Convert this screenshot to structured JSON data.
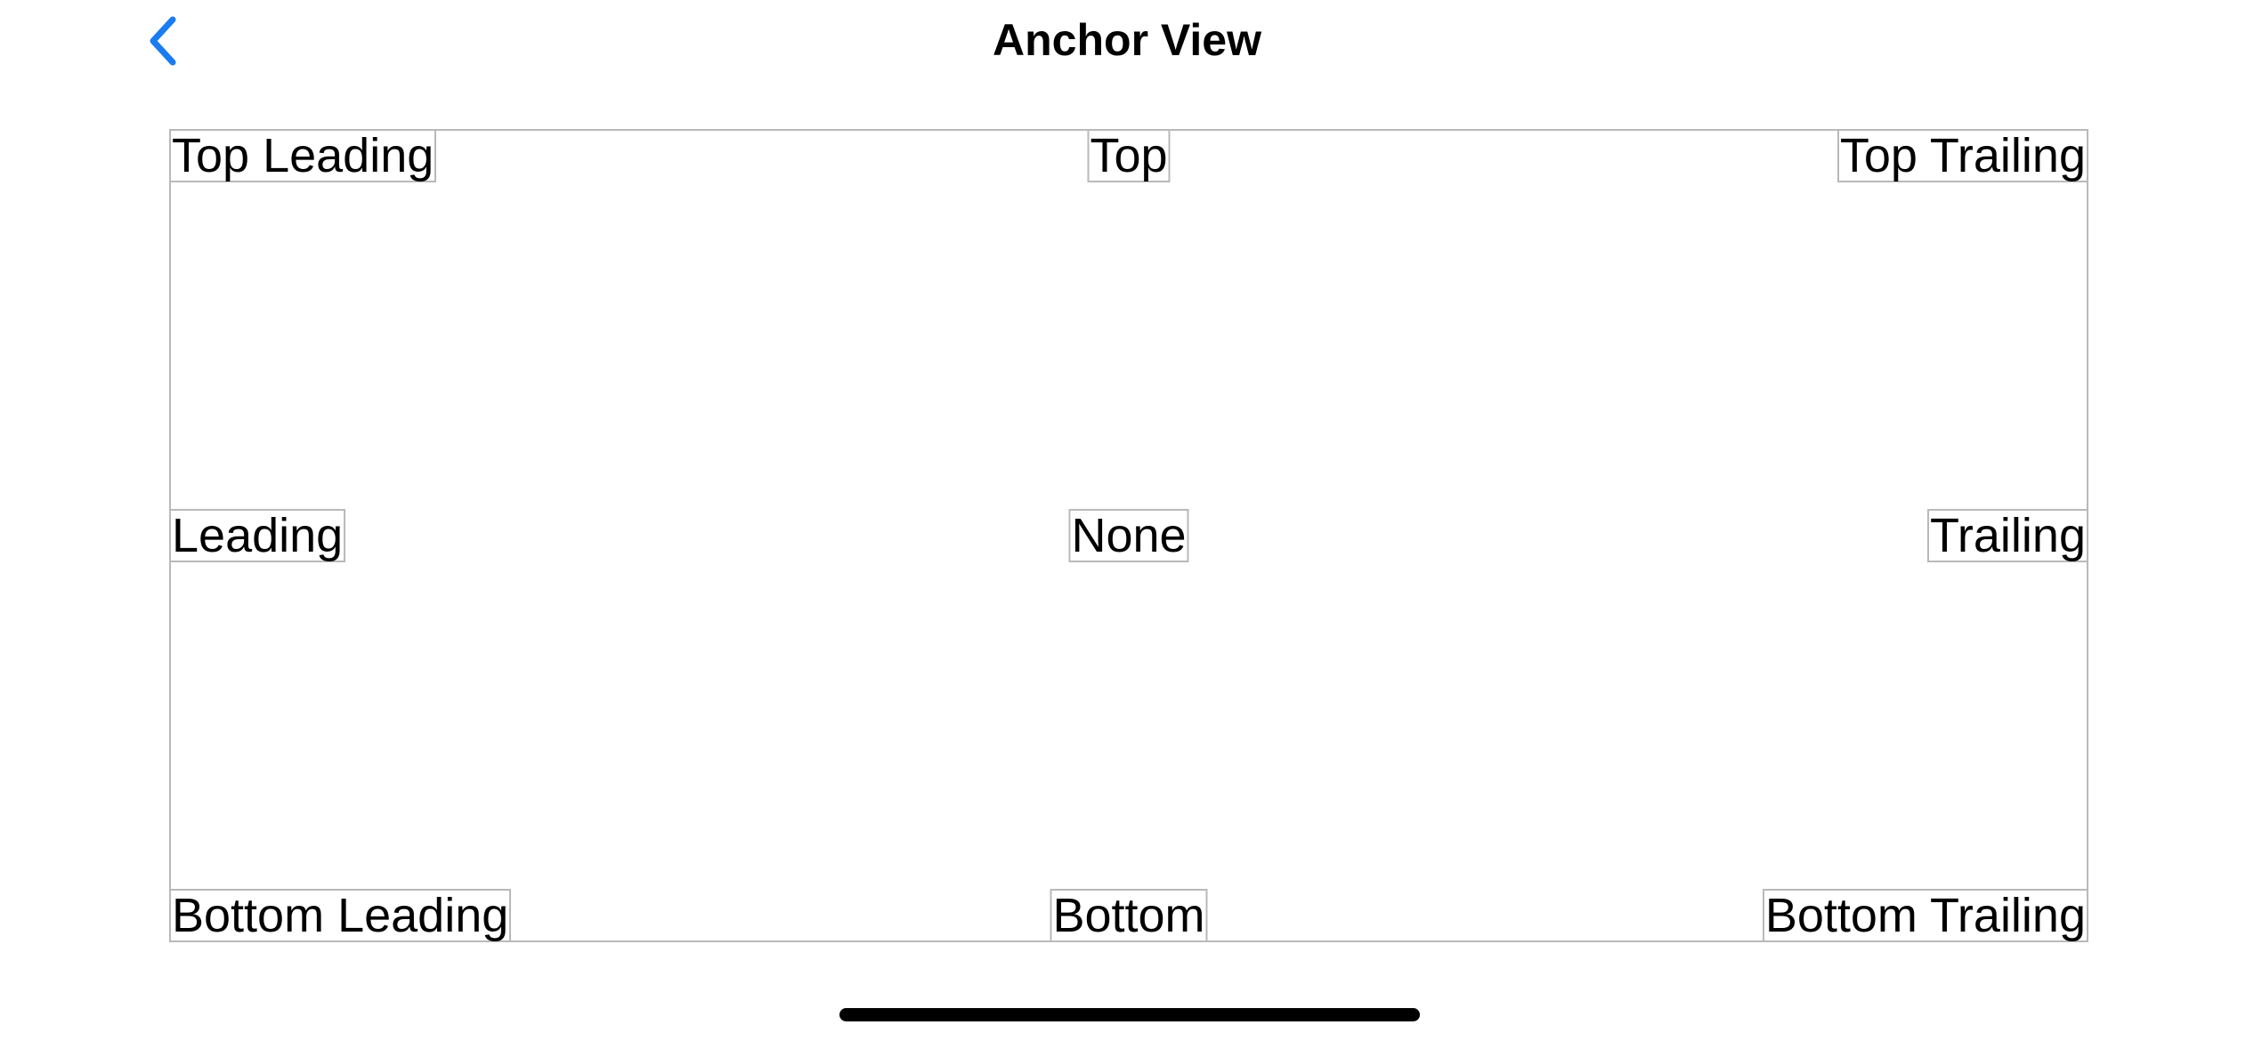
{
  "nav": {
    "title": "Anchor View",
    "back_icon": "chevron-left-icon",
    "accent_color": "#1a7cf0"
  },
  "anchor_view": {
    "labels": {
      "top_leading": "Top Leading",
      "top": "Top",
      "top_trailing": "Top Trailing",
      "leading": "Leading",
      "none": "None",
      "trailing": "Trailing",
      "bottom_leading": "Bottom Leading",
      "bottom": "Bottom",
      "bottom_trailing": "Bottom Trailing"
    },
    "border_color": "#b9b9b9"
  }
}
